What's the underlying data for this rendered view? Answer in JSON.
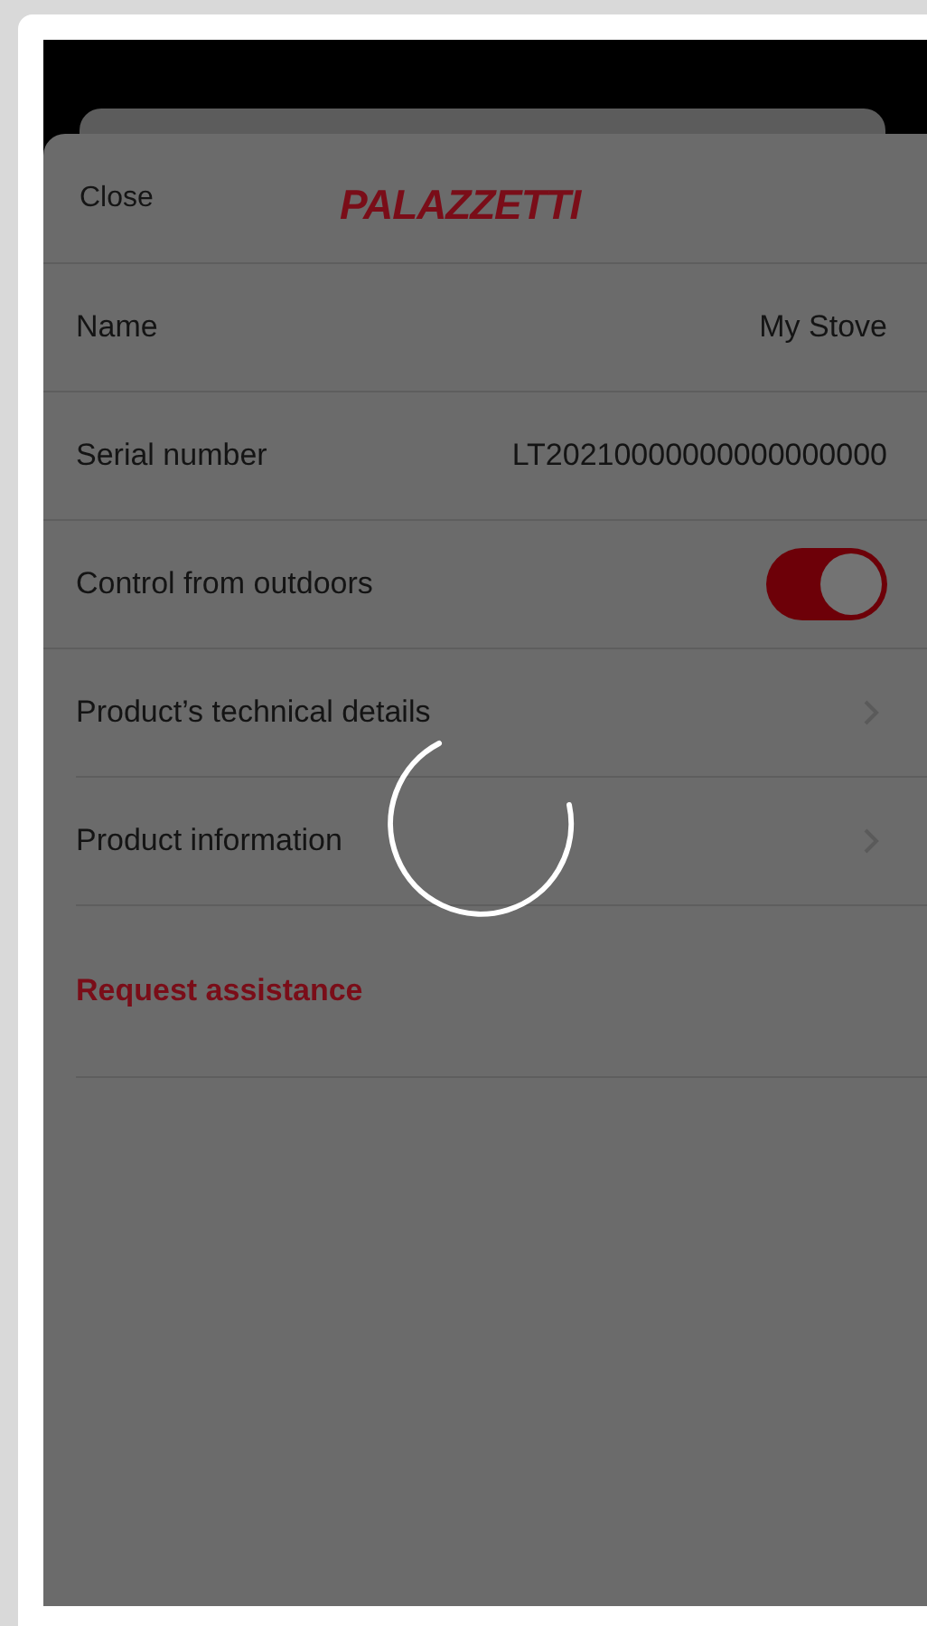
{
  "header": {
    "close": "Close",
    "logo": "PALAZZETTI"
  },
  "rows": [
    {
      "kind": "value",
      "label": "Name",
      "value": "My Stove"
    },
    {
      "kind": "value",
      "label": "Serial number",
      "value": "LT20210000000000000000"
    },
    {
      "kind": "toggle",
      "label": "Control from outdoors",
      "on": true
    },
    {
      "kind": "link",
      "label": "Product’s technical details"
    },
    {
      "kind": "link",
      "label": "Product information"
    }
  ],
  "assistance": "Request assistance"
}
